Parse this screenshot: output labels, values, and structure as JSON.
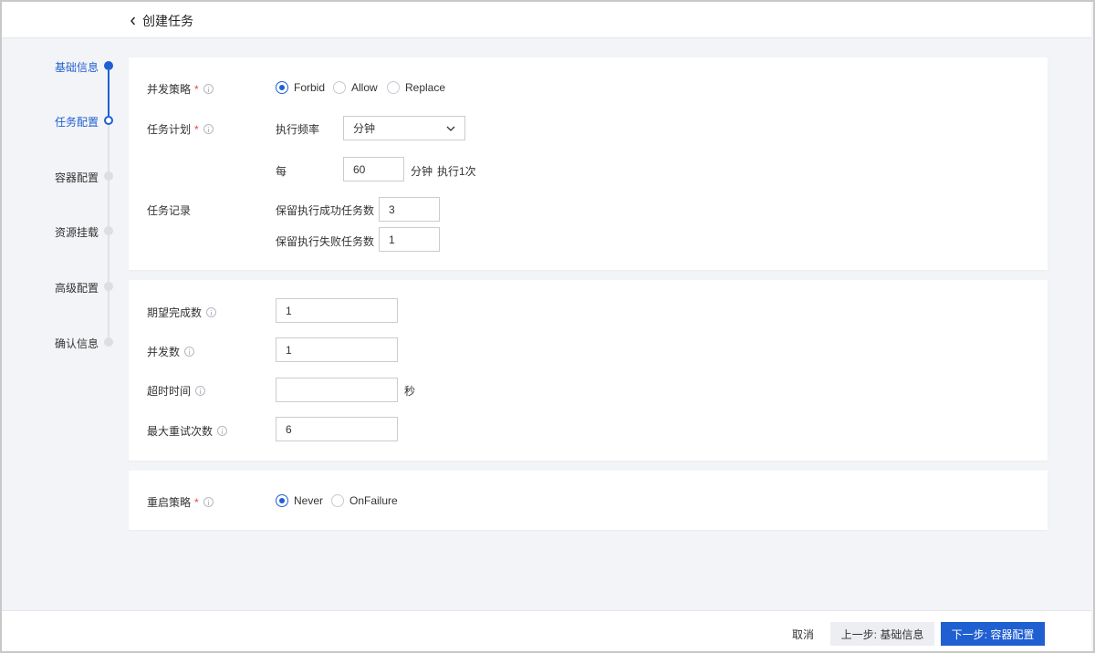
{
  "header": {
    "title": "创建任务"
  },
  "steps": [
    {
      "label": "基础信息",
      "state": "done"
    },
    {
      "label": "任务配置",
      "state": "current"
    },
    {
      "label": "容器配置",
      "state": "todo"
    },
    {
      "label": "资源挂载",
      "state": "todo"
    },
    {
      "label": "高级配置",
      "state": "todo"
    },
    {
      "label": "确认信息",
      "state": "todo"
    }
  ],
  "schedule_card": {
    "concurrency_policy": {
      "label": "并发策略",
      "options": [
        "Forbid",
        "Allow",
        "Replace"
      ],
      "selected": "Forbid"
    },
    "task_plan": {
      "label": "任务计划",
      "frequency_label": "执行频率",
      "frequency_value": "分钟",
      "every_label": "每",
      "every_value": "60",
      "unit_text": "分钟",
      "run_text": "执行1次"
    },
    "task_records": {
      "label": "任务记录",
      "success_label": "保留执行成功任务数",
      "success_value": "3",
      "failure_label": "保留执行失败任务数",
      "failure_value": "1"
    }
  },
  "job_card": {
    "completions": {
      "label": "期望完成数",
      "value": "1"
    },
    "parallelism": {
      "label": "并发数",
      "value": "1"
    },
    "timeout": {
      "label": "超时时间",
      "value": "",
      "unit": "秒"
    },
    "backoff_limit": {
      "label": "最大重试次数",
      "value": "6"
    }
  },
  "restart_card": {
    "label": "重启策略",
    "options": [
      "Never",
      "OnFailure"
    ],
    "selected": "Never"
  },
  "footer": {
    "cancel": "取消",
    "prev": "上一步: 基础信息",
    "next": "下一步: 容器配置"
  },
  "colors": {
    "primary": "#1f5fd1",
    "required": "#e54545"
  }
}
